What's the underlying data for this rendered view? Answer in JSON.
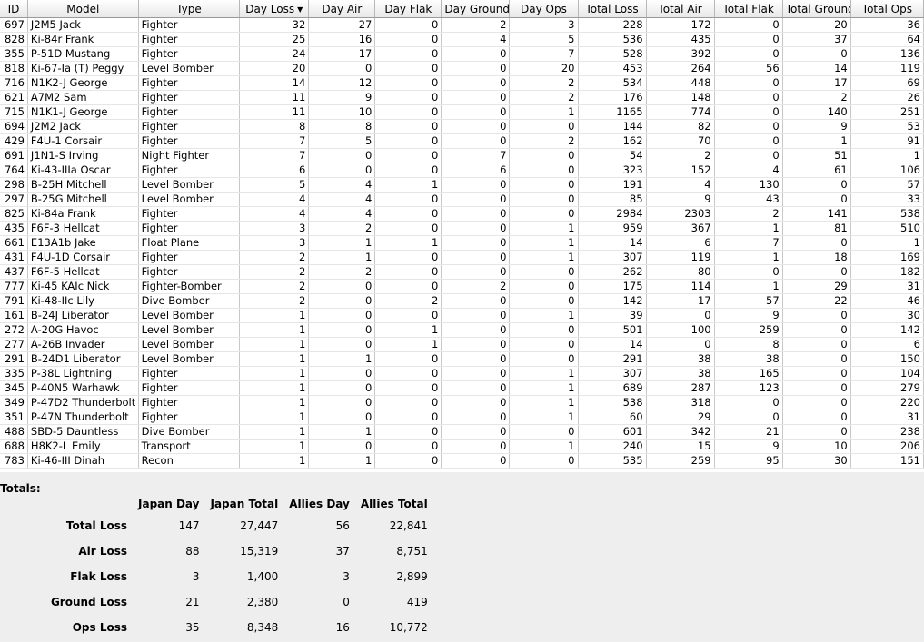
{
  "table": {
    "columns": [
      "ID",
      "Model",
      "Type",
      "Day Loss",
      "Day Air",
      "Day Flak",
      "Day Ground",
      "Day Ops",
      "Total Loss",
      "Total Air",
      "Total Flak",
      "Total Ground",
      "Total Ops"
    ],
    "sort_indicator": "▼",
    "rows": [
      [
        "697",
        "J2M5 Jack",
        "Fighter",
        "32",
        "27",
        "0",
        "2",
        "3",
        "228",
        "172",
        "0",
        "20",
        "36"
      ],
      [
        "828",
        "Ki-84r Frank",
        "Fighter",
        "25",
        "16",
        "0",
        "4",
        "5",
        "536",
        "435",
        "0",
        "37",
        "64"
      ],
      [
        "355",
        "P-51D Mustang",
        "Fighter",
        "24",
        "17",
        "0",
        "0",
        "7",
        "528",
        "392",
        "0",
        "0",
        "136"
      ],
      [
        "818",
        "Ki-67-Ia (T) Peggy",
        "Level Bomber",
        "20",
        "0",
        "0",
        "0",
        "20",
        "453",
        "264",
        "56",
        "14",
        "119"
      ],
      [
        "716",
        "N1K2-J George",
        "Fighter",
        "14",
        "12",
        "0",
        "0",
        "2",
        "534",
        "448",
        "0",
        "17",
        "69"
      ],
      [
        "621",
        "A7M2 Sam",
        "Fighter",
        "11",
        "9",
        "0",
        "0",
        "2",
        "176",
        "148",
        "0",
        "2",
        "26"
      ],
      [
        "715",
        "N1K1-J George",
        "Fighter",
        "11",
        "10",
        "0",
        "0",
        "1",
        "1165",
        "774",
        "0",
        "140",
        "251"
      ],
      [
        "694",
        "J2M2 Jack",
        "Fighter",
        "8",
        "8",
        "0",
        "0",
        "0",
        "144",
        "82",
        "0",
        "9",
        "53"
      ],
      [
        "429",
        "F4U-1 Corsair",
        "Fighter",
        "7",
        "5",
        "0",
        "0",
        "2",
        "162",
        "70",
        "0",
        "1",
        "91"
      ],
      [
        "691",
        "J1N1-S Irving",
        "Night Fighter",
        "7",
        "0",
        "0",
        "7",
        "0",
        "54",
        "2",
        "0",
        "51",
        "1"
      ],
      [
        "764",
        "Ki-43-IIIa Oscar",
        "Fighter",
        "6",
        "0",
        "0",
        "6",
        "0",
        "323",
        "152",
        "4",
        "61",
        "106"
      ],
      [
        "298",
        "B-25H Mitchell",
        "Level Bomber",
        "5",
        "4",
        "1",
        "0",
        "0",
        "191",
        "4",
        "130",
        "0",
        "57"
      ],
      [
        "297",
        "B-25G Mitchell",
        "Level Bomber",
        "4",
        "4",
        "0",
        "0",
        "0",
        "85",
        "9",
        "43",
        "0",
        "33"
      ],
      [
        "825",
        "Ki-84a Frank",
        "Fighter",
        "4",
        "4",
        "0",
        "0",
        "0",
        "2984",
        "2303",
        "2",
        "141",
        "538"
      ],
      [
        "435",
        "F6F-3 Hellcat",
        "Fighter",
        "3",
        "2",
        "0",
        "0",
        "1",
        "959",
        "367",
        "1",
        "81",
        "510"
      ],
      [
        "661",
        "E13A1b Jake",
        "Float Plane",
        "3",
        "1",
        "1",
        "0",
        "1",
        "14",
        "6",
        "7",
        "0",
        "1"
      ],
      [
        "431",
        "F4U-1D Corsair",
        "Fighter",
        "2",
        "1",
        "0",
        "0",
        "1",
        "307",
        "119",
        "1",
        "18",
        "169"
      ],
      [
        "437",
        "F6F-5 Hellcat",
        "Fighter",
        "2",
        "2",
        "0",
        "0",
        "0",
        "262",
        "80",
        "0",
        "0",
        "182"
      ],
      [
        "777",
        "Ki-45 KAIc Nick",
        "Fighter-Bomber",
        "2",
        "0",
        "0",
        "2",
        "0",
        "175",
        "114",
        "1",
        "29",
        "31"
      ],
      [
        "791",
        "Ki-48-IIc Lily",
        "Dive Bomber",
        "2",
        "0",
        "2",
        "0",
        "0",
        "142",
        "17",
        "57",
        "22",
        "46"
      ],
      [
        "161",
        "B-24J Liberator",
        "Level Bomber",
        "1",
        "0",
        "0",
        "0",
        "1",
        "39",
        "0",
        "9",
        "0",
        "30"
      ],
      [
        "272",
        "A-20G Havoc",
        "Level Bomber",
        "1",
        "0",
        "1",
        "0",
        "0",
        "501",
        "100",
        "259",
        "0",
        "142"
      ],
      [
        "277",
        "A-26B Invader",
        "Level Bomber",
        "1",
        "0",
        "1",
        "0",
        "0",
        "14",
        "0",
        "8",
        "0",
        "6"
      ],
      [
        "291",
        "B-24D1 Liberator",
        "Level Bomber",
        "1",
        "1",
        "0",
        "0",
        "0",
        "291",
        "38",
        "38",
        "0",
        "150"
      ],
      [
        "335",
        "P-38L Lightning",
        "Fighter",
        "1",
        "0",
        "0",
        "0",
        "1",
        "307",
        "38",
        "165",
        "0",
        "104"
      ],
      [
        "345",
        "P-40N5 Warhawk",
        "Fighter",
        "1",
        "0",
        "0",
        "0",
        "1",
        "689",
        "287",
        "123",
        "0",
        "279"
      ],
      [
        "349",
        "P-47D2 Thunderbolt",
        "Fighter",
        "1",
        "0",
        "0",
        "0",
        "1",
        "538",
        "318",
        "0",
        "0",
        "220"
      ],
      [
        "351",
        "P-47N Thunderbolt",
        "Fighter",
        "1",
        "0",
        "0",
        "0",
        "1",
        "60",
        "29",
        "0",
        "0",
        "31"
      ],
      [
        "488",
        "SBD-5 Dauntless",
        "Dive Bomber",
        "1",
        "1",
        "0",
        "0",
        "0",
        "601",
        "342",
        "21",
        "0",
        "238"
      ],
      [
        "688",
        "H8K2-L Emily",
        "Transport",
        "1",
        "0",
        "0",
        "0",
        "1",
        "240",
        "15",
        "9",
        "10",
        "206"
      ],
      [
        "783",
        "Ki-46-III Dinah",
        "Recon",
        "1",
        "1",
        "0",
        "0",
        "0",
        "535",
        "259",
        "95",
        "30",
        "151"
      ]
    ]
  },
  "totals": {
    "label": "Totals:",
    "columns": [
      "",
      "Japan Day",
      "Japan Total",
      "Allies Day",
      "Allies Total"
    ],
    "rows": [
      [
        "Total Loss",
        "147",
        "27,447",
        "56",
        "22,841"
      ],
      [
        "Air Loss",
        "88",
        "15,319",
        "37",
        "8,751"
      ],
      [
        "Flak Loss",
        "3",
        "1,400",
        "3",
        "2,899"
      ],
      [
        "Ground Loss",
        "21",
        "2,380",
        "0",
        "419"
      ],
      [
        "Ops Loss",
        "35",
        "8,348",
        "16",
        "10,772"
      ]
    ]
  }
}
